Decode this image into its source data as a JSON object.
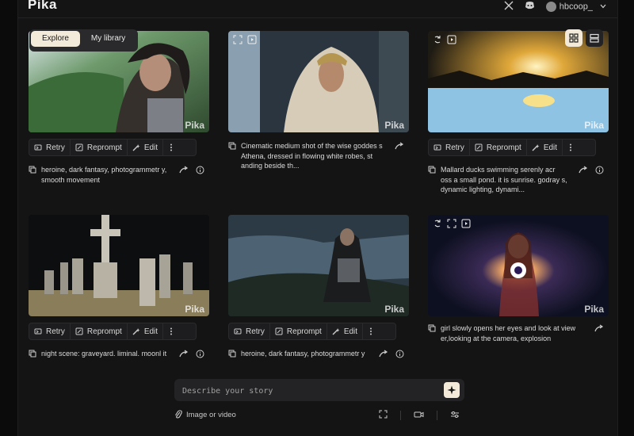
{
  "app": {
    "logo": "Pika",
    "username": "hbcoop_"
  },
  "tabs": {
    "explore": "Explore",
    "library": "My library"
  },
  "watermark": "Pika",
  "actions": {
    "retry": "Retry",
    "reprompt": "Reprompt",
    "edit": "Edit"
  },
  "cards": [
    {
      "caption": "heroine, dark fantasy, photogrammetr y, smooth movement"
    },
    {
      "caption": "Cinematic medium shot of the wise goddes s Athena, dressed in flowing white robes, st anding beside th..."
    },
    {
      "caption": "Mallard ducks swimming serenly acr oss a small pond. it is sunrise. godray s, dynamic lighting, dynami..."
    },
    {
      "caption": "night scene: graveyard. liminal. moonl it"
    },
    {
      "caption": "heroine, dark fantasy, photogrammetr y"
    },
    {
      "caption": "girl slowly opens her eyes and look at view er,looking at the camera, explosion"
    }
  ],
  "prompt": {
    "placeholder": "Describe your story",
    "attach_label": "Image or video"
  },
  "colors": {
    "accent": "#f3ead9",
    "background": "#141415"
  }
}
